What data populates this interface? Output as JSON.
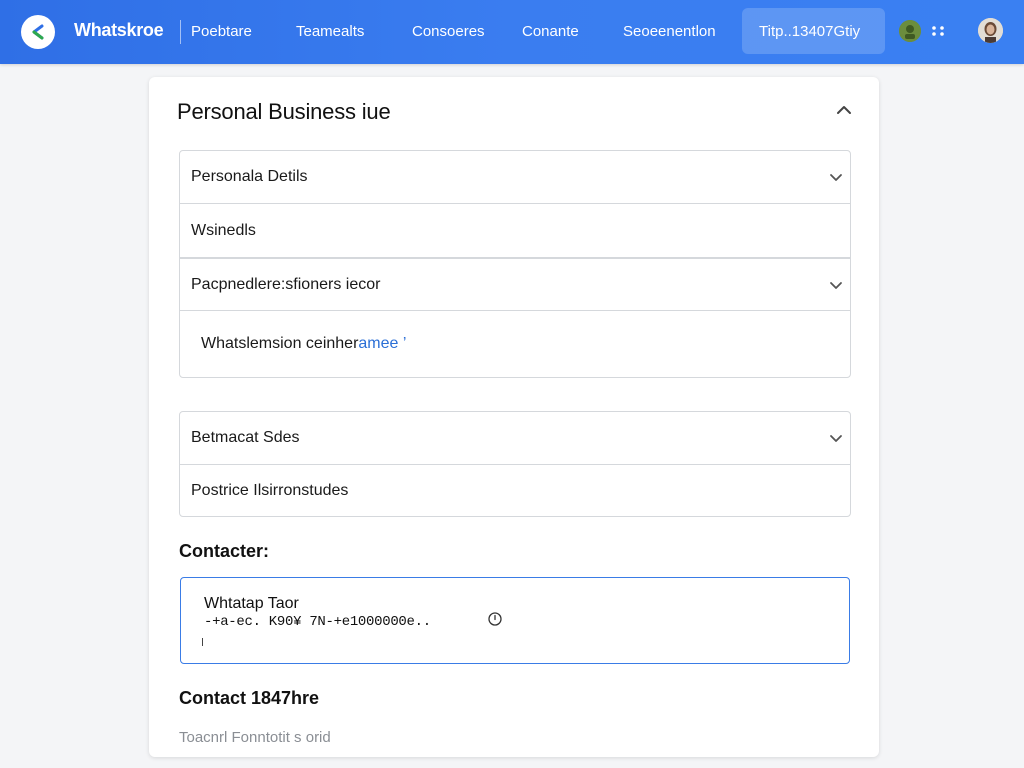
{
  "header": {
    "app_name": "Whatskroe",
    "nav": [
      "Poebtare",
      "Teamealts",
      "Consoeres",
      "Conante",
      "Seoeenentlon"
    ],
    "active_nav": "Titp..13407Gtiy",
    "brand_color": "#2f6fe6",
    "icons": [
      "whatsapp-logo-icon",
      "status-icon",
      "more-options-icon",
      "avatar"
    ]
  },
  "card": {
    "title": "Personal Business iue",
    "rows": [
      {
        "label": "Personala Detils",
        "expandable": true
      },
      {
        "label": "Wsinedls",
        "expandable": false
      },
      {
        "label": "Pacpnedlere:sfioners iecor",
        "expandable": true
      },
      {
        "label_prefix": "Whatslemsion ceinher",
        "label_link": "amee",
        "label_suffix": " ’",
        "expandable": false
      },
      {
        "label": "Betmacat Sdes",
        "expandable": true
      },
      {
        "label": "Postrice Ilsirronstudes",
        "expandable": false
      }
    ],
    "contacts": {
      "label": "Contacter:",
      "name": "Whtatap Taor",
      "number": "-+a-ec. K90¥  7N-+e1000000e.."
    },
    "contact_footer": {
      "label": "Contact 1847hre",
      "placeholder": "Toacnrl Fonntotit s orid"
    }
  }
}
